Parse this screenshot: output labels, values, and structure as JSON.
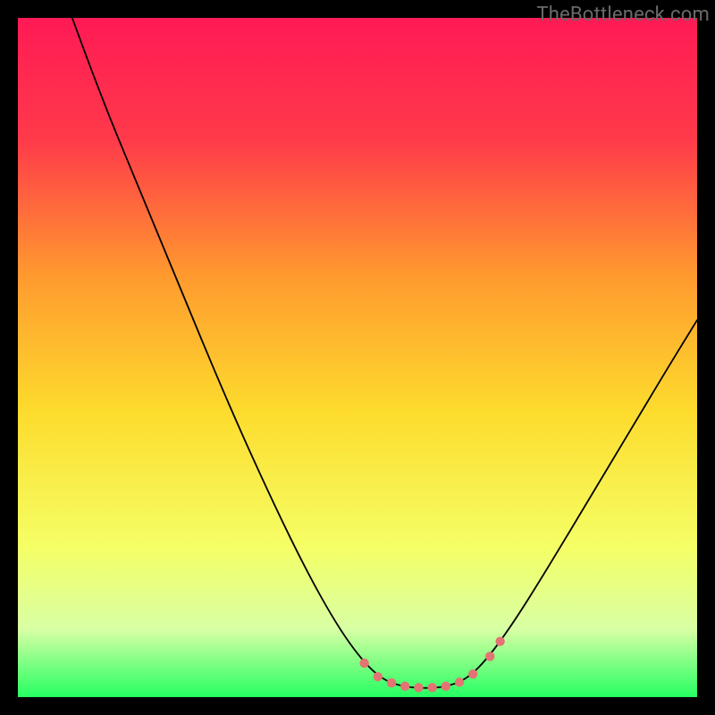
{
  "watermark": "TheBottleneck.com",
  "chart_data": {
    "type": "line",
    "title": "",
    "xlabel": "",
    "ylabel": "",
    "xlim": [
      0,
      100
    ],
    "ylim": [
      0,
      100
    ],
    "background": {
      "gradient_stops": [
        {
          "t": 0.0,
          "color": "#ff1a55"
        },
        {
          "t": 0.18,
          "color": "#ff3a4a"
        },
        {
          "t": 0.38,
          "color": "#ff9a2e"
        },
        {
          "t": 0.58,
          "color": "#fddc2d"
        },
        {
          "t": 0.78,
          "color": "#f5ff66"
        },
        {
          "t": 0.9,
          "color": "#d8ffa4"
        },
        {
          "t": 1.0,
          "color": "#25ff62"
        }
      ]
    },
    "series": [
      {
        "name": "bottleneck-curve",
        "color": "#000000",
        "width": 1.8,
        "points": [
          {
            "x": 8.0,
            "y": 100.0
          },
          {
            "x": 12.0,
            "y": 89.0
          },
          {
            "x": 18.0,
            "y": 74.5
          },
          {
            "x": 24.0,
            "y": 60.0
          },
          {
            "x": 30.0,
            "y": 45.5
          },
          {
            "x": 36.0,
            "y": 32.0
          },
          {
            "x": 42.0,
            "y": 19.5
          },
          {
            "x": 47.0,
            "y": 10.5
          },
          {
            "x": 51.0,
            "y": 5.0
          },
          {
            "x": 54.0,
            "y": 2.4
          },
          {
            "x": 57.0,
            "y": 1.5
          },
          {
            "x": 60.0,
            "y": 1.3
          },
          {
            "x": 63.0,
            "y": 1.5
          },
          {
            "x": 66.0,
            "y": 2.6
          },
          {
            "x": 69.0,
            "y": 5.5
          },
          {
            "x": 73.0,
            "y": 11.0
          },
          {
            "x": 78.0,
            "y": 19.0
          },
          {
            "x": 84.0,
            "y": 29.0
          },
          {
            "x": 90.0,
            "y": 39.0
          },
          {
            "x": 96.0,
            "y": 49.0
          },
          {
            "x": 100.0,
            "y": 55.5
          }
        ]
      },
      {
        "name": "highlight-dots",
        "color": "#e57373",
        "radius": 5.2,
        "points": [
          {
            "x": 51.0,
            "y": 5.0
          },
          {
            "x": 53.0,
            "y": 3.0
          },
          {
            "x": 55.0,
            "y": 2.1
          },
          {
            "x": 57.0,
            "y": 1.6
          },
          {
            "x": 59.0,
            "y": 1.4
          },
          {
            "x": 61.0,
            "y": 1.4
          },
          {
            "x": 63.0,
            "y": 1.6
          },
          {
            "x": 65.0,
            "y": 2.2
          },
          {
            "x": 67.0,
            "y": 3.4
          },
          {
            "x": 69.5,
            "y": 6.0
          },
          {
            "x": 71.0,
            "y": 8.2
          }
        ]
      }
    ]
  }
}
